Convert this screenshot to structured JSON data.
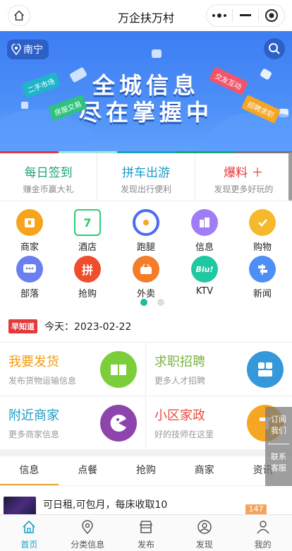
{
  "header": {
    "title": "万企扶万村"
  },
  "banner": {
    "city": "南宁",
    "line1": "全城信息",
    "line2": "尽在掌握中",
    "tags": [
      "二手市场",
      "房屋交易",
      "交友互动",
      "招聘求职"
    ]
  },
  "quick": [
    {
      "title": "每日签到",
      "sub": "赚金币赢大礼",
      "color": "#1aa37a"
    },
    {
      "title": "拼车出游",
      "sub": "发现出行便利",
      "color": "#1a9bc4"
    },
    {
      "title": "爆料 ＋",
      "sub": "发现更多好玩的",
      "color": "#e5383b"
    }
  ],
  "grid": [
    {
      "label": "商家",
      "icon": "shop-icon",
      "glyph": "▯",
      "color": "#f5a623"
    },
    {
      "label": "酒店",
      "icon": "calendar-icon",
      "glyph": "7",
      "color": "#2ecc71"
    },
    {
      "label": "跑腿",
      "icon": "errand-icon",
      "glyph": "◔",
      "color": "#4a6cf7"
    },
    {
      "label": "信息",
      "icon": "building-icon",
      "glyph": "▥",
      "color": "#9b6ef3"
    },
    {
      "label": "购物",
      "icon": "shopping-icon",
      "glyph": "✓",
      "color": "#f7b92c"
    },
    {
      "label": "部落",
      "icon": "chat-icon",
      "glyph": "…",
      "color": "#6a7ff0"
    },
    {
      "label": "抢购",
      "icon": "groupbuy-icon",
      "glyph": "拼",
      "color": "#ef4d2e"
    },
    {
      "label": "外卖",
      "icon": "basket-icon",
      "glyph": "▭",
      "color": "#f57c28"
    },
    {
      "label": "KTV",
      "icon": "ktv-icon",
      "glyph": "Biu!",
      "color": "#1fc8a0"
    },
    {
      "label": "新闻",
      "icon": "signpost-icon",
      "glyph": "⊢",
      "color": "#4d8ff7"
    }
  ],
  "news": {
    "badge": "早知道",
    "text": "今天：2023-02-22"
  },
  "cards": [
    {
      "title": "我要发货",
      "sub": "发布货物运输信息",
      "color": "#f39c12",
      "icon": "book-icon",
      "bg": "#7ccd3a"
    },
    {
      "title": "求职招聘",
      "sub": "更多人才招聘",
      "color": "#7cb342",
      "icon": "grid-icon",
      "bg": "#3498db"
    },
    {
      "title": "附近商家",
      "sub": "更多商家信息",
      "color": "#1a9bc4",
      "icon": "pacman-icon",
      "bg": "#8e44ad"
    },
    {
      "title": "小区家政",
      "sub": "好的技师在这里",
      "color": "#e74c3c",
      "icon": "service-icon",
      "bg": "#f5a623"
    }
  ],
  "tabs": [
    "信息",
    "点餐",
    "抢购",
    "商家",
    "资讯"
  ],
  "list": {
    "text": "可日租,可包月，每床收取10",
    "badge": "147"
  },
  "float": {
    "top": "订阅\n我们",
    "bottom": "联系\n客服"
  },
  "bottom_nav": [
    "首页",
    "分类信息",
    "发布",
    "发现",
    "我的"
  ]
}
